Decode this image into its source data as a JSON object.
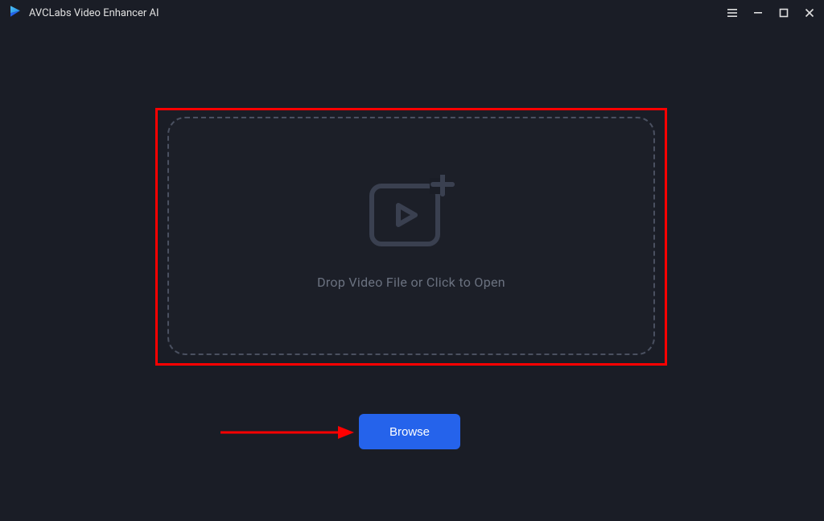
{
  "app": {
    "title": "AVCLabs Video Enhancer AI"
  },
  "dropzone": {
    "text": "Drop Video File or Click to Open"
  },
  "buttons": {
    "browse": "Browse"
  },
  "icons": {
    "logo": "play-logo",
    "menu": "menu-icon",
    "minimize": "minimize-icon",
    "maximize": "maximize-icon",
    "close": "close-icon",
    "video_add": "video-add-icon"
  },
  "colors": {
    "bg": "#1a1d26",
    "accent": "#2563eb",
    "muted": "#6b7280",
    "annotation": "#ff0000"
  }
}
